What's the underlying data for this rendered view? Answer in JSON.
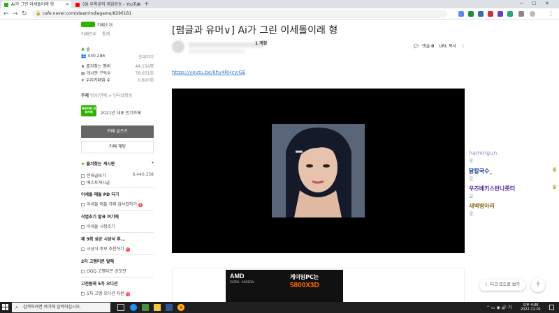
{
  "browser": {
    "tabs": [
      {
        "title": "Ai가 그린 이세돌이래 형",
        "active": true
      },
      {
        "title": "(9) 우왁굳의 게임방송 - YouTub",
        "active": false
      }
    ],
    "new_tab": "+",
    "url": "cafe.naver.com/steamindiegame/8296181",
    "window_min": "─",
    "window_max": "☐",
    "window_close": "✕"
  },
  "sidebar": {
    "cafe_top": [
      "카페소개",
      "카페관리",
      "통계"
    ],
    "level": "숲",
    "member_count": "430,286",
    "invite": "초대하기",
    "stats": [
      {
        "label": "즐겨찾는 멤버",
        "value": "44,154명"
      },
      {
        "label": "게시판 구독수",
        "value": "78,651회"
      },
      {
        "label": "우리카페앱 수",
        "value": "0,800회"
      }
    ],
    "theme_label": "주제",
    "theme_value": "방송/연예 > 인터넷방송",
    "award_badge": "NAVER 대표카페",
    "award_text": "2021년 대표 인기카페",
    "write_button": "카페 글쓰기",
    "chat_button": "카페 채팅",
    "favorites_title": "즐겨찾는 게시판",
    "favorites": [
      {
        "label": "전체글보기",
        "count": "6,440,338"
      },
      {
        "label": "베스트게시글",
        "count": ""
      }
    ],
    "sections": [
      {
        "title": "이세돌 애들 PD 되기",
        "items": [
          "이세돌 애들 가짜 감사합하기"
        ]
      },
      {
        "title": "삭엽초기 발표 여기에",
        "items": [
          "이세돌 시청조기"
        ]
      },
      {
        "title": "제 9회 성균 시상식 후...",
        "items": [
          "시상식 후보 추천하기"
        ]
      },
      {
        "title": "2차 고멤티콘 발매",
        "items": [
          "OGQ 고멤티콘 공모전"
        ]
      },
      {
        "title": "고전원래 5차 오디션",
        "items": [
          "5차 고멤 오디션 지원"
        ]
      }
    ]
  },
  "post": {
    "title": "[펌글과 유머∨] Ai가 그린 이세돌이래 형",
    "author_rank": "1 계정",
    "comments_label": "댓글",
    "comments_count": "0",
    "url_copy": "URL 복사",
    "link": "https://youtu.be/khy4RHcyjGE"
  },
  "ad": {
    "brand": "AMD",
    "brand_sub": "RYZEN · RADEON",
    "headline": "게이밍PC는",
    "product": "5800X3D"
  },
  "chat": {
    "messages": [
      {
        "name": "hamingun",
        "msg": "오",
        "color": "#9b8ccf"
      },
      {
        "name": "닭칼국수_",
        "msg": "오",
        "color": "#1a3d8f"
      },
      {
        "name": "우즈베키스탄나룻터",
        "msg": "오",
        "color": "#5a2ca0"
      },
      {
        "name": "새벽병아리",
        "msg": "오",
        "color": "#8a6d1a"
      }
    ]
  },
  "floating": {
    "dark_mode": "다크 모드로 보기",
    "top": "⤒"
  },
  "taskbar": {
    "search_placeholder": "검색하려면 여기에 입력하십시오.",
    "time": "오후 4:06",
    "date": "2022-11-01"
  },
  "colors": {
    "naver_green": "#2db400",
    "link_blue": "#3b7bd4",
    "badge_red": "#ff3333"
  }
}
